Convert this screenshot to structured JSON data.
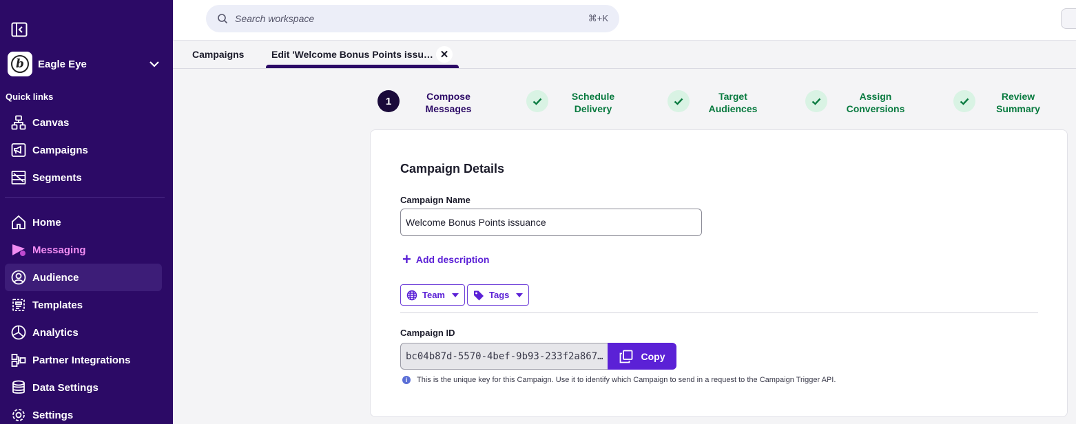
{
  "sidebar": {
    "workspace": {
      "name": "Eagle Eye",
      "logo_letter": "b"
    },
    "quick_links_label": "Quick links",
    "quick_links": [
      {
        "label": "Canvas",
        "icon": "canvas-icon"
      },
      {
        "label": "Campaigns",
        "icon": "megaphone-icon"
      },
      {
        "label": "Segments",
        "icon": "segments-icon"
      }
    ],
    "nav": [
      {
        "label": "Home",
        "icon": "home-icon"
      },
      {
        "label": "Messaging",
        "icon": "messaging-icon",
        "highlight": true
      },
      {
        "label": "Audience",
        "icon": "audience-icon",
        "active": true
      },
      {
        "label": "Templates",
        "icon": "templates-icon"
      },
      {
        "label": "Analytics",
        "icon": "analytics-icon"
      },
      {
        "label": "Partner Integrations",
        "icon": "integrations-icon"
      },
      {
        "label": "Data Settings",
        "icon": "database-icon"
      },
      {
        "label": "Settings",
        "icon": "gear-icon"
      }
    ]
  },
  "topbar": {
    "search_placeholder": "Search workspace",
    "search_shortcut": "⌘+K"
  },
  "tabs": [
    {
      "label": "Campaigns"
    },
    {
      "label": "Edit 'Welcome Bonus Points issu…",
      "active": true,
      "closable": true
    }
  ],
  "stepper": [
    {
      "number": "1",
      "label_line1": "Compose",
      "label_line2": "Messages",
      "state": "current"
    },
    {
      "label_line1": "Schedule",
      "label_line2": "Delivery",
      "state": "done"
    },
    {
      "label_line1": "Target",
      "label_line2": "Audiences",
      "state": "done"
    },
    {
      "label_line1": "Assign",
      "label_line2": "Conversions",
      "state": "done"
    },
    {
      "label_line1": "Review",
      "label_line2": "Summary",
      "state": "done"
    }
  ],
  "card": {
    "title": "Campaign Details",
    "name_label": "Campaign Name",
    "name_value": "Welcome Bonus Points issuance",
    "add_description": "Add description",
    "team_label": "Team",
    "tags_label": "Tags",
    "id_label": "Campaign ID",
    "id_value": "bc04b87d-5570-4bef-9b93-233f2a867…",
    "copy_label": "Copy",
    "help_text": "This is the unique key for this Campaign. Use it to identify which Campaign to send in a request to the Campaign Trigger API."
  },
  "colors": {
    "sidebar_bg": "#2c0a66",
    "accent": "#5b21d6",
    "messaging_pink": "#f08cf2",
    "success_green": "#087a3f"
  }
}
